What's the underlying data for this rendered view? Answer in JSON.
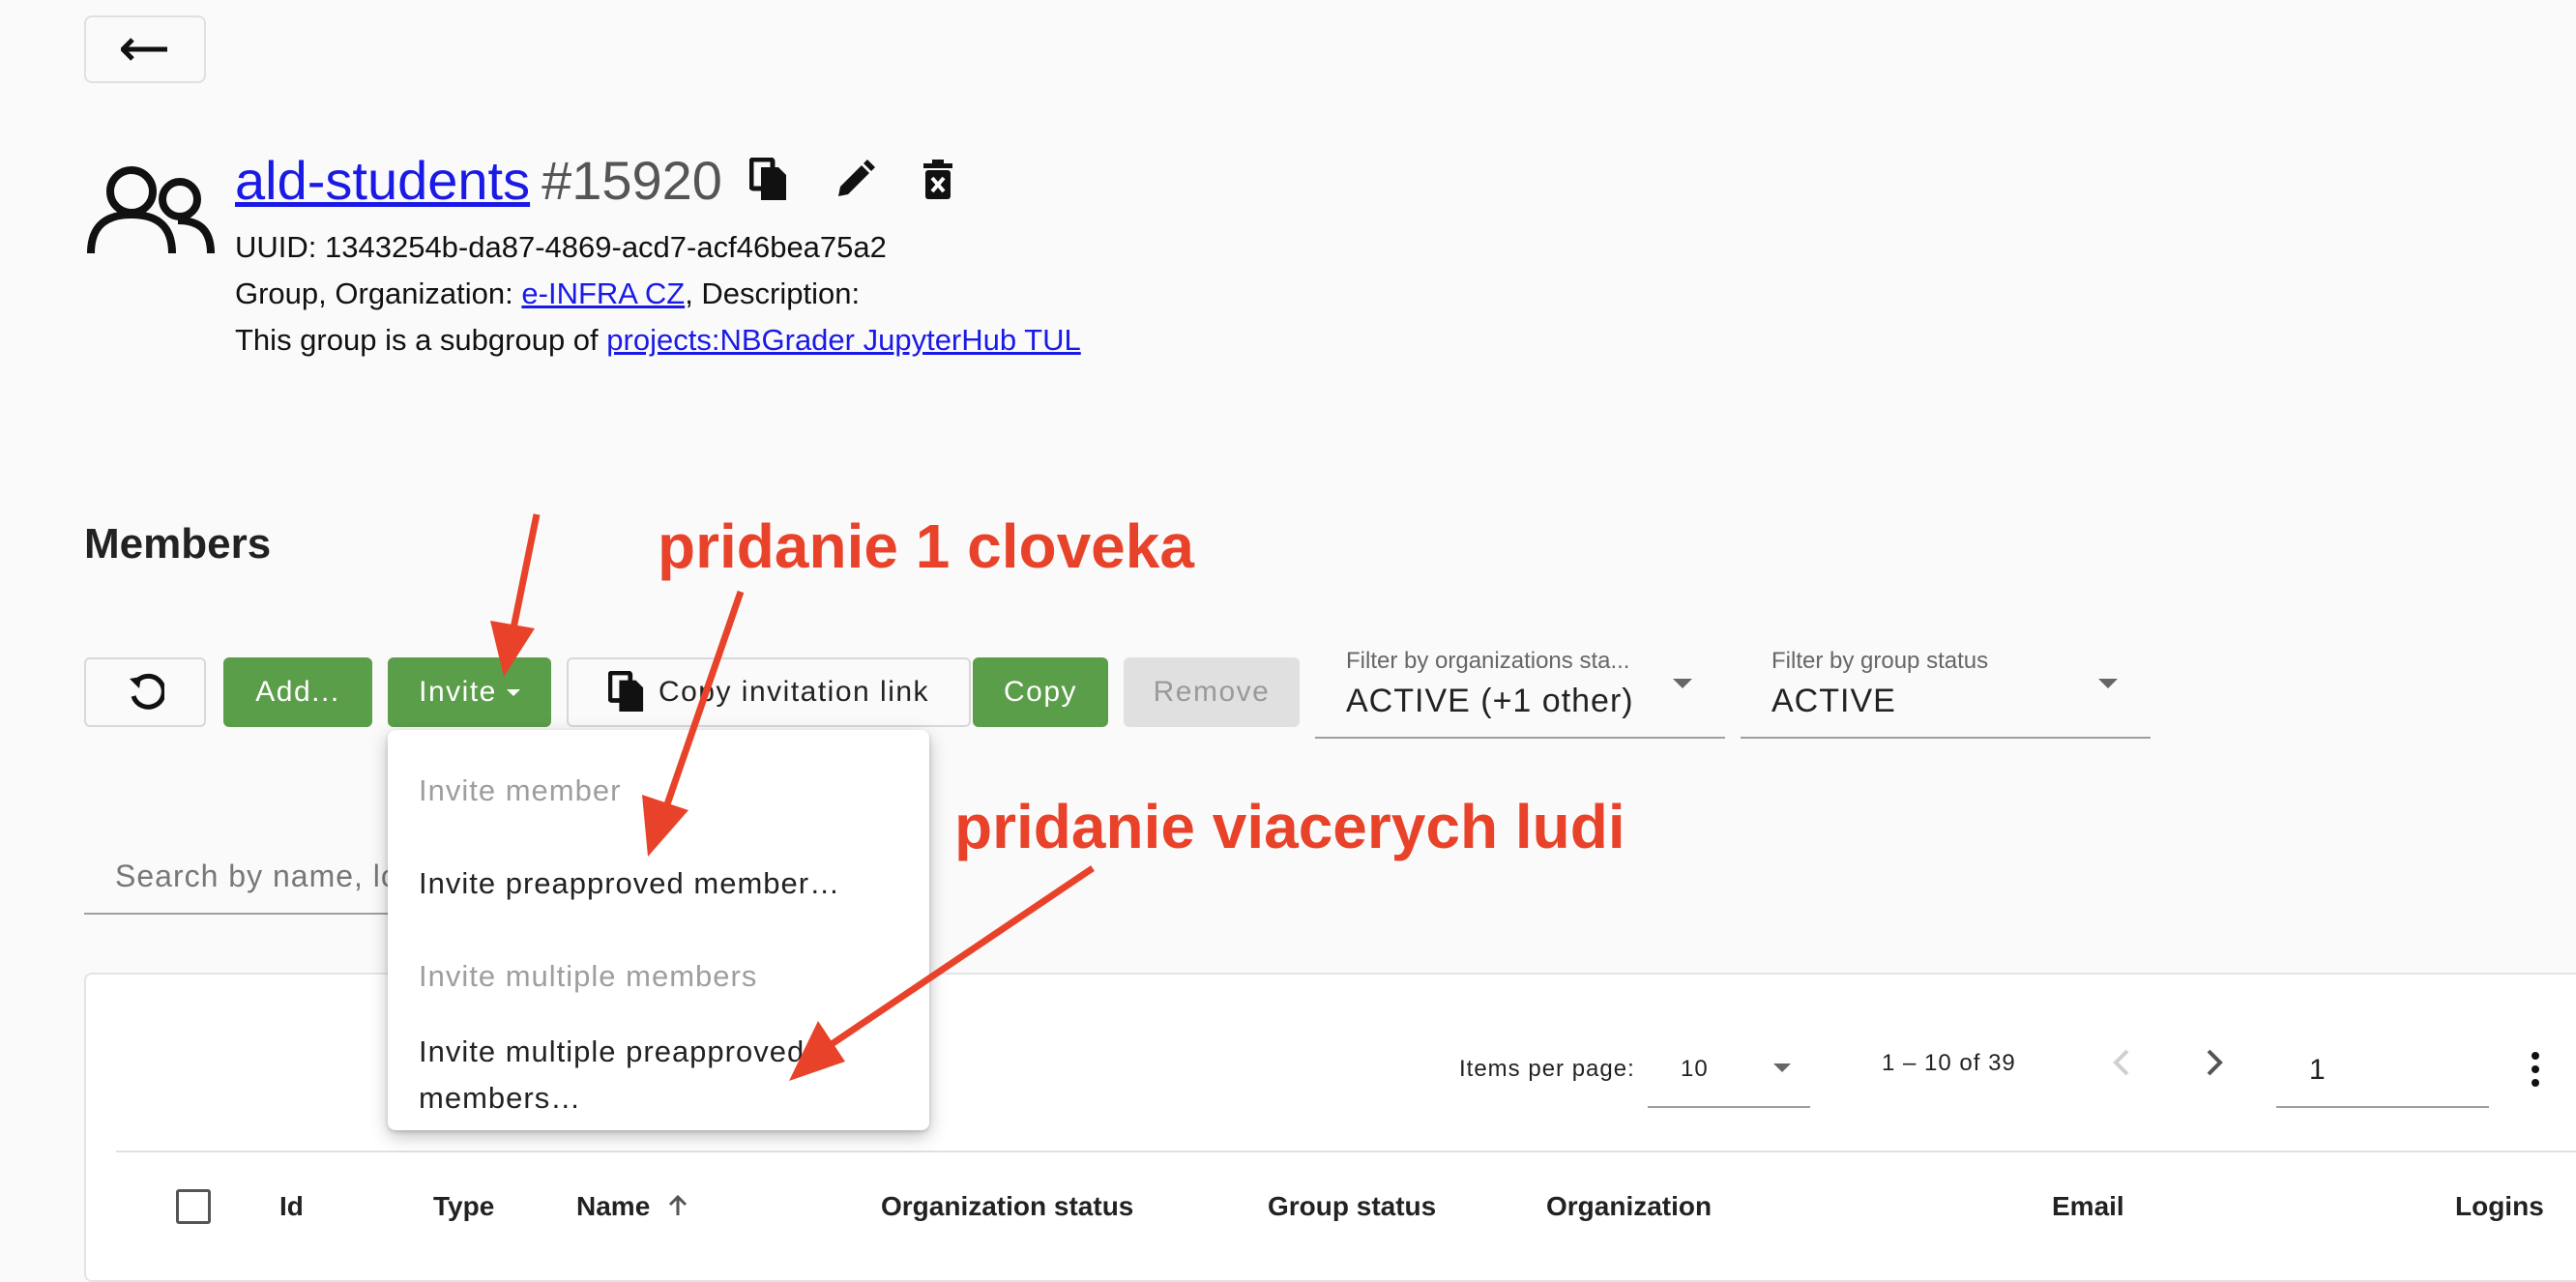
{
  "header": {
    "group_name": "ald-students",
    "group_id": "#15920",
    "uuid_line": "UUID: 1343254b-da87-4869-acd7-acf46bea75a2",
    "meta_prefix": "Group, Organization: ",
    "organization_link": "e-INFRA CZ",
    "meta_suffix": ", Description:",
    "subgroup_prefix": "This group is a subgroup of ",
    "parent_link": "projects:NBGrader JupyterHub TUL"
  },
  "members": {
    "title": "Members",
    "toolbar": {
      "add_label": "Add...",
      "invite_label": "Invite",
      "copy_link_label": "Copy invitation link",
      "copy_label": "Copy",
      "remove_label": "Remove"
    },
    "filters": {
      "org_status_label": "Filter by organizations sta...",
      "org_status_value": "ACTIVE (+1 other)",
      "group_status_label": "Filter by group status",
      "group_status_value": "ACTIVE"
    },
    "search_placeholder": "Search by name, lo",
    "invite_menu": {
      "invite_member": "Invite member",
      "invite_preapproved": "Invite preapproved member…",
      "invite_multiple": "Invite multiple members",
      "invite_multiple_preapproved_1": "Invite multiple preapproved",
      "invite_multiple_preapproved_2": "members…"
    },
    "paginator": {
      "items_per_page_label": "Items per page:",
      "items_per_page_value": "10",
      "range_label": "1 – 10 of 39",
      "page_value": "1"
    },
    "columns": [
      "Id",
      "Type",
      "Name",
      "Organization status",
      "Group status",
      "Organization",
      "Email",
      "Logins"
    ]
  },
  "annotations": {
    "single": "pridanie 1 cloveka",
    "multiple": "pridanie viacerych ludi",
    "color": "#e8432a"
  },
  "colors": {
    "accent_green": "#5b9e4a",
    "link_blue": "#1a1ae6"
  }
}
